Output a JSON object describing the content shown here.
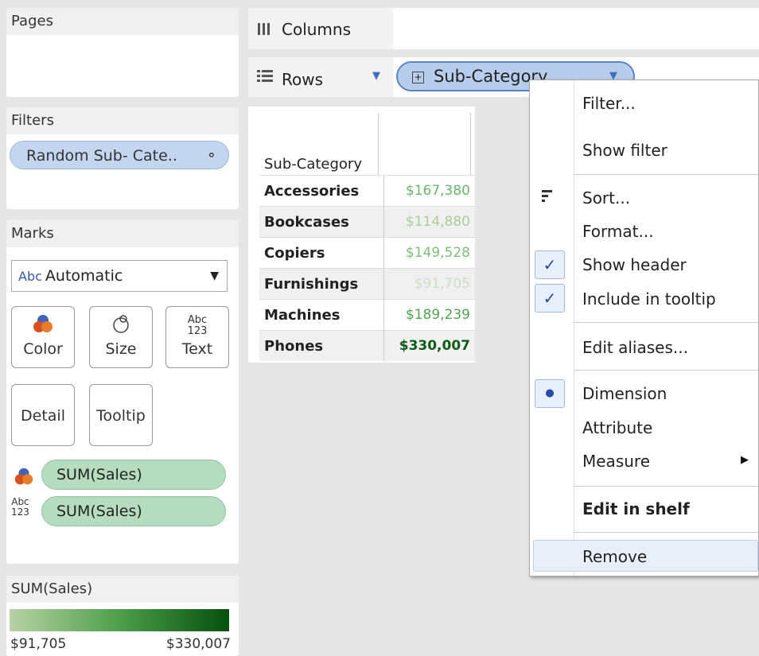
{
  "pages": {
    "title": "Pages"
  },
  "filters": {
    "title": "Filters",
    "pill": "Random Sub- Cate.."
  },
  "marks": {
    "title": "Marks",
    "mark_type": "Automatic",
    "mark_type_icon": "Abc",
    "cards": {
      "color": "Color",
      "size": "Size",
      "text": "Text",
      "text_icon": [
        "Abc",
        "123"
      ],
      "detail": "Detail",
      "tooltip": "Tooltip"
    },
    "fields": [
      {
        "icon": "color-icon",
        "label": "SUM(Sales)"
      },
      {
        "icon": "text-icon",
        "label": "SUM(Sales)",
        "icon_text": [
          "Abc",
          "123"
        ]
      }
    ]
  },
  "legend": {
    "title": "SUM(Sales)",
    "min": "$91,705",
    "max": "$330,007",
    "colors": [
      "#b8d2a5",
      "#05500f"
    ]
  },
  "shelves": {
    "columns": "Columns",
    "rows": "Rows",
    "rows_pill": "Sub-Category"
  },
  "view": {
    "header": "Sub-Category",
    "rows": [
      {
        "name": "Accessories",
        "value": "$167,380",
        "color": "#6bb56c"
      },
      {
        "name": "Bookcases",
        "value": "$114,880",
        "color": "#a8cd9c"
      },
      {
        "name": "Copiers",
        "value": "$149,528",
        "color": "#7fbf77"
      },
      {
        "name": "Furnishings",
        "value": "$91,705",
        "color": "#c9dfc0"
      },
      {
        "name": "Machines",
        "value": "$189,239",
        "color": "#4fa452"
      },
      {
        "name": "Phones",
        "value": "$330,007",
        "color": "#0c5c17"
      }
    ]
  },
  "context_menu": {
    "filter": "Filter...",
    "show_filter": "Show filter",
    "sort": "Sort...",
    "format": "Format...",
    "show_header": "Show header",
    "include_tooltip": "Include in tooltip",
    "edit_aliases": "Edit aliases...",
    "dimension": "Dimension",
    "attribute": "Attribute",
    "measure": "Measure",
    "edit_in_shelf": "Edit in shelf",
    "remove": "Remove"
  }
}
